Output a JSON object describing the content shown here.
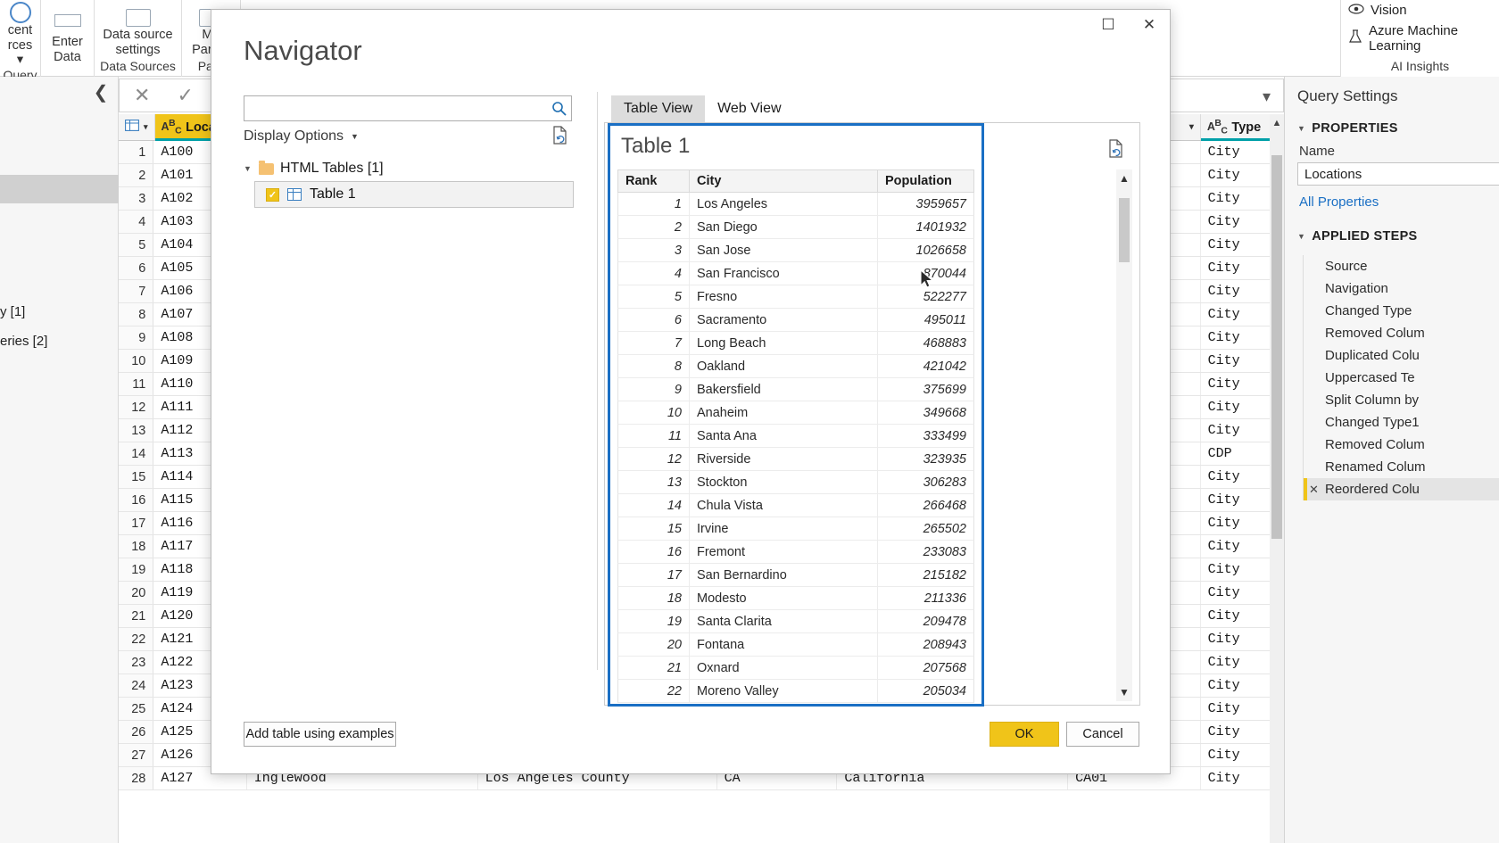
{
  "ribbon": {
    "groups": [
      {
        "label": "cent\nrces ▾",
        "footer": "Query"
      },
      {
        "label": "Enter\nData",
        "footer": ""
      },
      {
        "label": "Data source\nsettings",
        "footer": "Data Sources"
      },
      {
        "label": "Ma\nParam",
        "footer": "Para"
      }
    ],
    "ai": {
      "items": [
        "Vision",
        "Azure Machine Learning"
      ],
      "footer": "AI Insights",
      "vision_icon": "eye-icon",
      "aml_icon": "flask-icon"
    }
  },
  "queries_pane": {
    "items": [
      "y [1]",
      "eries [2]"
    ],
    "collapse_icon": "chevron-left-icon"
  },
  "formula_bar": {
    "cancel_icon": "x-icon",
    "accept_icon": "check-icon",
    "expand_icon": "chevron-down-icon"
  },
  "grid": {
    "columns": [
      {
        "key": "loc",
        "label": "Locati",
        "type_tag": "ABC",
        "selected": true
      },
      {
        "key": "type",
        "label": "Type",
        "type_tag": "ABC",
        "selected": false
      }
    ],
    "rows": [
      {
        "n": 1,
        "loc": "A100",
        "type": "City"
      },
      {
        "n": 2,
        "loc": "A101",
        "type": "City"
      },
      {
        "n": 3,
        "loc": "A102",
        "type": "City"
      },
      {
        "n": 4,
        "loc": "A103",
        "type": "City"
      },
      {
        "n": 5,
        "loc": "A104",
        "type": "City"
      },
      {
        "n": 6,
        "loc": "A105",
        "type": "City"
      },
      {
        "n": 7,
        "loc": "A106",
        "type": "City"
      },
      {
        "n": 8,
        "loc": "A107",
        "type": "City"
      },
      {
        "n": 9,
        "loc": "A108",
        "type": "City"
      },
      {
        "n": 10,
        "loc": "A109",
        "type": "City"
      },
      {
        "n": 11,
        "loc": "A110",
        "type": "City"
      },
      {
        "n": 12,
        "loc": "A111",
        "type": "City"
      },
      {
        "n": 13,
        "loc": "A112",
        "type": "City"
      },
      {
        "n": 14,
        "loc": "A113",
        "type": "CDP"
      },
      {
        "n": 15,
        "loc": "A114",
        "type": "City"
      },
      {
        "n": 16,
        "loc": "A115",
        "type": "City"
      },
      {
        "n": 17,
        "loc": "A116",
        "type": "City"
      },
      {
        "n": 18,
        "loc": "A117",
        "type": "City"
      },
      {
        "n": 19,
        "loc": "A118",
        "type": "City"
      },
      {
        "n": 20,
        "loc": "A119",
        "type": "City"
      },
      {
        "n": 21,
        "loc": "A120",
        "type": "City"
      },
      {
        "n": 22,
        "loc": "A121",
        "type": "City"
      },
      {
        "n": 23,
        "loc": "A122",
        "type": "City"
      },
      {
        "n": 24,
        "loc": "A123",
        "type": "City"
      },
      {
        "n": 25,
        "loc": "A124",
        "type": "City"
      },
      {
        "n": 26,
        "loc": "A125",
        "type": "City"
      },
      {
        "n": 27,
        "loc": "A126",
        "type": "City"
      },
      {
        "n": 28,
        "loc": "A127",
        "type": "City"
      }
    ],
    "last_row_text": {
      "city": "Inglewood",
      "county": "Los Angeles County",
      "state_abbr": "CA",
      "state": "California",
      "code": "CA01"
    }
  },
  "query_settings": {
    "title": "Query Settings",
    "properties_section": "PROPERTIES",
    "name_label": "Name",
    "name_value": "Locations",
    "all_properties_link": "All Properties",
    "applied_steps_section": "APPLIED STEPS",
    "steps": [
      {
        "label": "Source",
        "active": false
      },
      {
        "label": "Navigation",
        "active": false
      },
      {
        "label": "Changed Type",
        "active": false
      },
      {
        "label": "Removed Colum",
        "active": false
      },
      {
        "label": "Duplicated Colu",
        "active": false
      },
      {
        "label": "Uppercased Te",
        "active": false
      },
      {
        "label": "Split Column by",
        "active": false
      },
      {
        "label": "Changed Type1",
        "active": false
      },
      {
        "label": "Removed Colum",
        "active": false
      },
      {
        "label": "Renamed Colum",
        "active": false
      },
      {
        "label": "Reordered Colu",
        "active": true
      }
    ],
    "delete_step_icon": "x-icon"
  },
  "navigator": {
    "title": "Navigator",
    "titlebar": {
      "maximize_icon": "maximize-icon",
      "close_icon": "close-icon",
      "maximize_glyph": "☐",
      "close_glyph": "✕"
    },
    "search": {
      "value": "",
      "placeholder": "",
      "icon": "search-icon"
    },
    "display_options": {
      "label": "Display Options",
      "caret_icon": "chevron-down-icon"
    },
    "refresh_left_icon": "refresh-page-icon",
    "tree": {
      "root_label": "HTML Tables [1]",
      "root_expand_icon": "triangle-down-icon",
      "folder_icon": "folder-icon",
      "items": [
        {
          "label": "Table 1",
          "checked": true,
          "icon": "table-icon",
          "selected": true
        }
      ]
    },
    "tabs": [
      {
        "label": "Table View",
        "active": true
      },
      {
        "label": "Web View",
        "active": false
      }
    ],
    "preview": {
      "title": "Table 1",
      "refresh_icon": "refresh-page-icon",
      "scroll_up_icon": "chevron-up-icon",
      "scroll_down_icon": "chevron-down-icon"
    },
    "footer": {
      "add_table_label": "Add table using examples",
      "ok_label": "OK",
      "cancel_label": "Cancel"
    },
    "cursor_icon": "mouse-pointer-icon"
  },
  "table_data": {
    "type": "table",
    "title": "Table 1",
    "columns": [
      "Rank",
      "City",
      "Population"
    ],
    "rows": [
      [
        1,
        "Los Angeles",
        3959657
      ],
      [
        2,
        "San Diego",
        1401932
      ],
      [
        3,
        "San Jose",
        1026658
      ],
      [
        4,
        "San Francisco",
        870044
      ],
      [
        5,
        "Fresno",
        522277
      ],
      [
        6,
        "Sacramento",
        495011
      ],
      [
        7,
        "Long Beach",
        468883
      ],
      [
        8,
        "Oakland",
        421042
      ],
      [
        9,
        "Bakersfield",
        375699
      ],
      [
        10,
        "Anaheim",
        349668
      ],
      [
        11,
        "Santa Ana",
        333499
      ],
      [
        12,
        "Riverside",
        323935
      ],
      [
        13,
        "Stockton",
        306283
      ],
      [
        14,
        "Chula Vista",
        266468
      ],
      [
        15,
        "Irvine",
        265502
      ],
      [
        16,
        "Fremont",
        233083
      ],
      [
        17,
        "San Bernardino",
        215182
      ],
      [
        18,
        "Modesto",
        211336
      ],
      [
        19,
        "Santa Clarita",
        209478
      ],
      [
        20,
        "Fontana",
        208943
      ],
      [
        21,
        "Oxnard",
        207568
      ],
      [
        22,
        "Moreno Valley",
        205034
      ]
    ]
  },
  "colors": {
    "accent_yellow": "#f0c419",
    "focus_blue": "#1a6fc4",
    "link_blue": "#1a6fc4",
    "teal_underline": "#00a0a8"
  }
}
